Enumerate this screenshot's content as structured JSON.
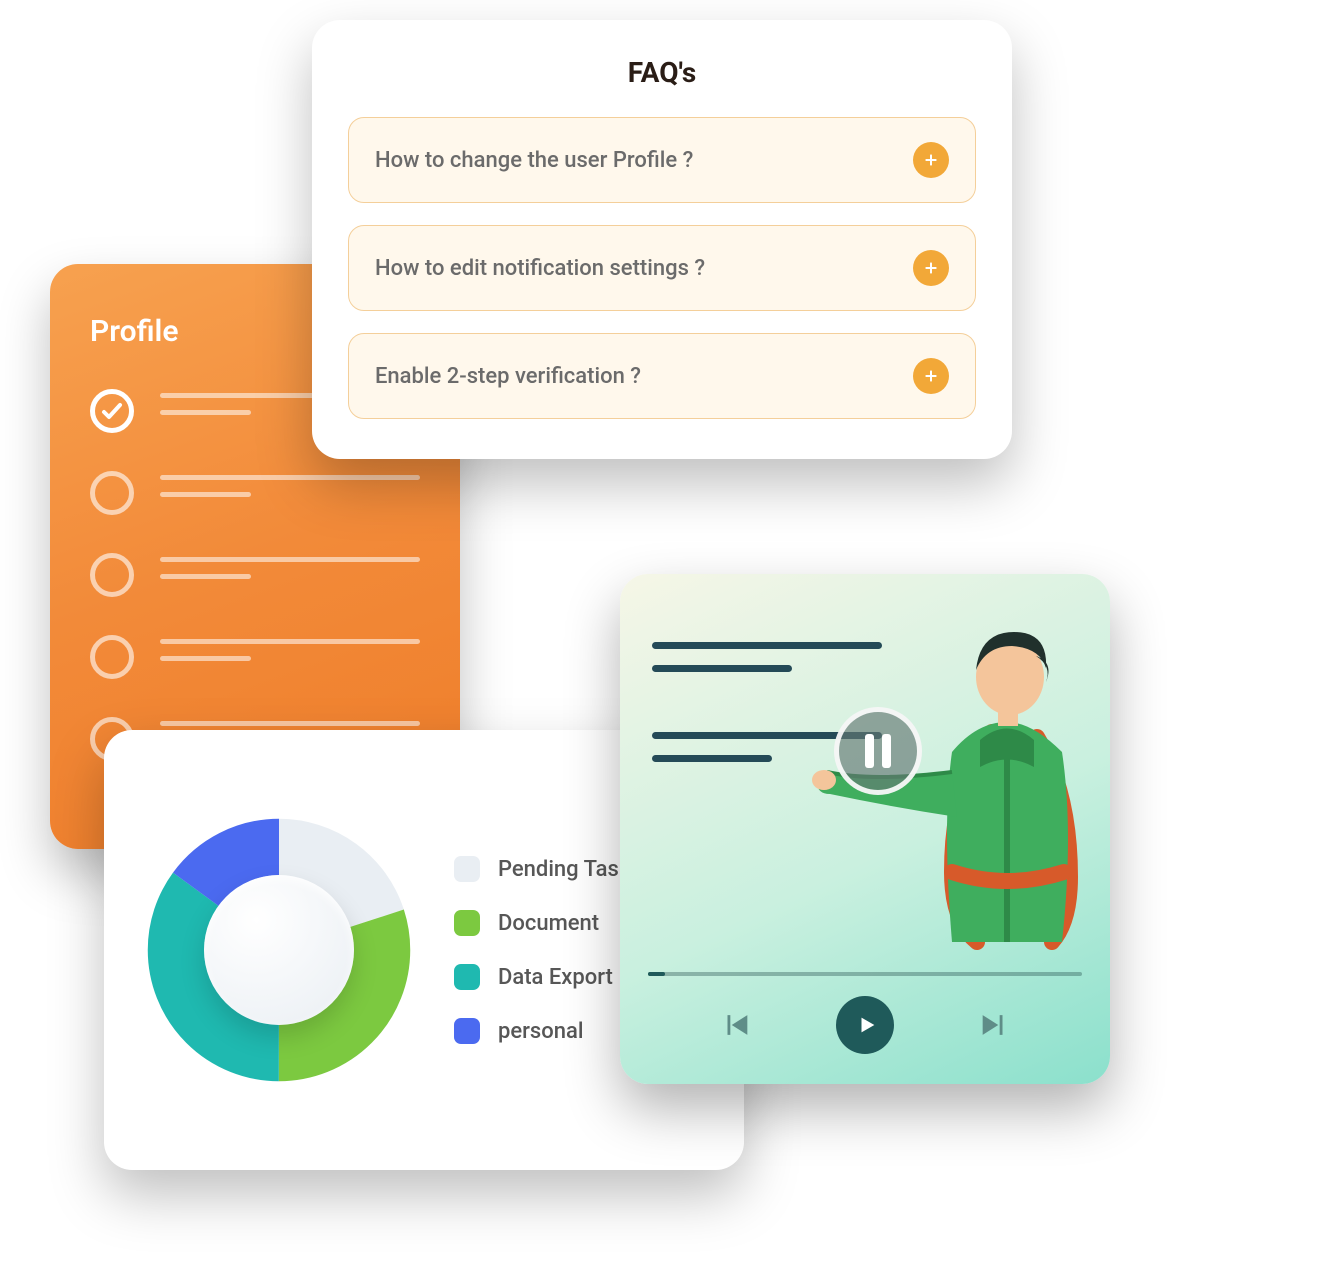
{
  "profile": {
    "title": "Profile"
  },
  "faq": {
    "title": "FAQ's",
    "items": [
      {
        "question": "How to change the user Profile ?"
      },
      {
        "question": "How to edit notification settings ?"
      },
      {
        "question": "Enable 2-step verification ?"
      }
    ]
  },
  "storage": {
    "legend": [
      {
        "label": "Pending Tasks",
        "color": "#e9eef3"
      },
      {
        "label": "Document",
        "color": "#7cc940"
      },
      {
        "label": "Data Export",
        "color": "#1fb9b0"
      },
      {
        "label": "personal",
        "color": "#4b6af0"
      }
    ]
  },
  "chart_data": {
    "type": "pie",
    "title": "",
    "categories": [
      "Pending Tasks",
      "Document",
      "Data Export",
      "personal"
    ],
    "values": [
      20,
      30,
      35,
      15
    ],
    "colors": [
      "#e9eef3",
      "#7cc940",
      "#1fb9b0",
      "#4b6af0"
    ]
  },
  "media": {
    "state": "paused"
  }
}
